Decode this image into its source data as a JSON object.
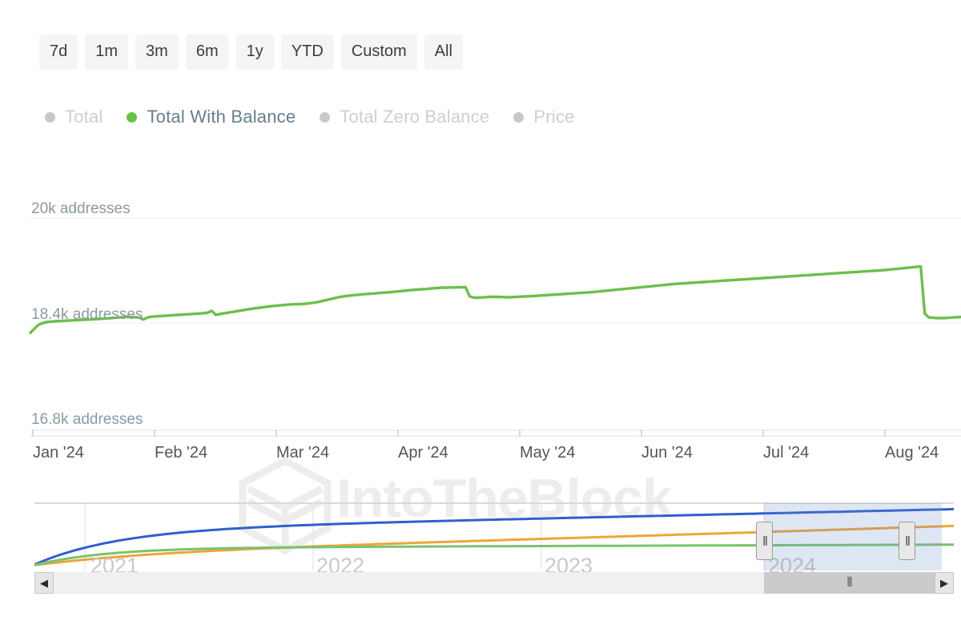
{
  "range_selector": {
    "buttons": [
      {
        "label": "7d"
      },
      {
        "label": "1m"
      },
      {
        "label": "3m"
      },
      {
        "label": "6m"
      },
      {
        "label": "1y"
      },
      {
        "label": "YTD"
      },
      {
        "label": "Custom"
      },
      {
        "label": "All"
      }
    ]
  },
  "legend": {
    "items": [
      {
        "label": "Total",
        "active": false,
        "color": "#c8c8c8"
      },
      {
        "label": "Total With Balance",
        "active": true,
        "color": "#68c24a"
      },
      {
        "label": "Total Zero Balance",
        "active": false,
        "color": "#c8c8c8"
      },
      {
        "label": "Price",
        "active": false,
        "color": "#c8c8c8"
      }
    ]
  },
  "watermark": {
    "text": "IntoTheBlock",
    "logo_icon": "intotheblock-hexagon-logo",
    "color": "#ededed"
  },
  "navigator": {
    "year_labels": [
      "2021",
      "2022",
      "2023",
      "2024"
    ],
    "series_colors": [
      "#2f5fd0",
      "#eda53a",
      "#7ac36f"
    ],
    "selection_fill": "#6d8fc9",
    "left_arrow": "◀",
    "right_arrow": "▶",
    "handle_grip": "‖",
    "thumb_grip": "⫴"
  },
  "chart_data": {
    "type": "line",
    "title": "",
    "xlabel": "",
    "ylabel": "addresses",
    "grid": true,
    "legend_position": "top",
    "ytick_labels": [
      "20k addresses",
      "18.4k addresses",
      "16.8k addresses"
    ],
    "ytick_values": [
      20000,
      18400,
      16800
    ],
    "ylim": [
      16800,
      20000
    ],
    "xtick_labels": [
      "Jan '24",
      "Feb '24",
      "Mar '24",
      "Apr '24",
      "May '24",
      "Jun '24",
      "Jul '24",
      "Aug '24"
    ],
    "series": [
      {
        "name": "Total With Balance",
        "color": "#6cbf4b",
        "values": [
          18270,
          18330,
          18390,
          18415,
          18430,
          18438,
          18442,
          18446,
          18450,
          18452,
          18455,
          18458,
          18462,
          18465,
          18468,
          18470,
          18474,
          18478,
          18482,
          18486,
          18490,
          18495,
          18500,
          18505,
          18510,
          18508,
          18504,
          18500,
          18470,
          18498,
          18512,
          18516,
          18520,
          18524,
          18528,
          18532,
          18536,
          18540,
          18544,
          18548,
          18552,
          18556,
          18560,
          18566,
          18572,
          18600,
          18540,
          18552,
          18562,
          18572,
          18582,
          18592,
          18602,
          18612,
          18622,
          18632,
          18640,
          18648,
          18656,
          18664,
          18670,
          18676,
          18682,
          18688,
          18694,
          18698,
          18700,
          18702,
          18706,
          18712,
          18720,
          18730,
          18742,
          18756,
          18770,
          18784,
          18798,
          18810,
          18820,
          18828,
          18834,
          18840,
          18846,
          18852,
          18856,
          18860,
          18866,
          18872,
          18876,
          18880,
          18886,
          18892,
          18898,
          18904,
          18910,
          18916,
          18920,
          18924,
          18928,
          18934,
          18940,
          18944,
          18948,
          18950,
          18952,
          18952,
          18954,
          18956,
          18958,
          18820,
          18800,
          18798,
          18802,
          18806,
          18810,
          18812,
          18810,
          18808,
          18806,
          18804,
          18808,
          18812,
          18816,
          18818,
          18820,
          18824,
          18828,
          18832,
          18836,
          18840,
          18844,
          18848,
          18852,
          18856,
          18860,
          18864,
          18868,
          18872,
          18876,
          18880,
          18886,
          18892,
          18898,
          18904,
          18910,
          18916,
          18922,
          18928,
          18934,
          18940,
          18946,
          18952,
          18958,
          18964,
          18970,
          18976,
          18982,
          18988,
          18994,
          19000,
          19006,
          19010,
          19014,
          19018,
          19022,
          19026,
          19030,
          19034,
          19038,
          19042,
          19046,
          19050,
          19054,
          19058,
          19062,
          19066,
          19070,
          19074,
          19078,
          19082,
          19086,
          19090,
          19094,
          19098,
          19102,
          19106,
          19110,
          19114,
          19118,
          19122,
          19126,
          19130,
          19134,
          19138,
          19142,
          19146,
          19150,
          19154,
          19158,
          19162,
          19166,
          19170,
          19174,
          19178,
          19182,
          19186,
          19190,
          19194,
          19198,
          19202,
          19206,
          19210,
          19214,
          19220,
          19226,
          19232,
          19238,
          19244,
          19250,
          19256,
          19262,
          19268,
          18560,
          18500,
          18495,
          18492,
          18490,
          18492,
          18496,
          18500,
          18504,
          18508
        ]
      }
    ]
  }
}
